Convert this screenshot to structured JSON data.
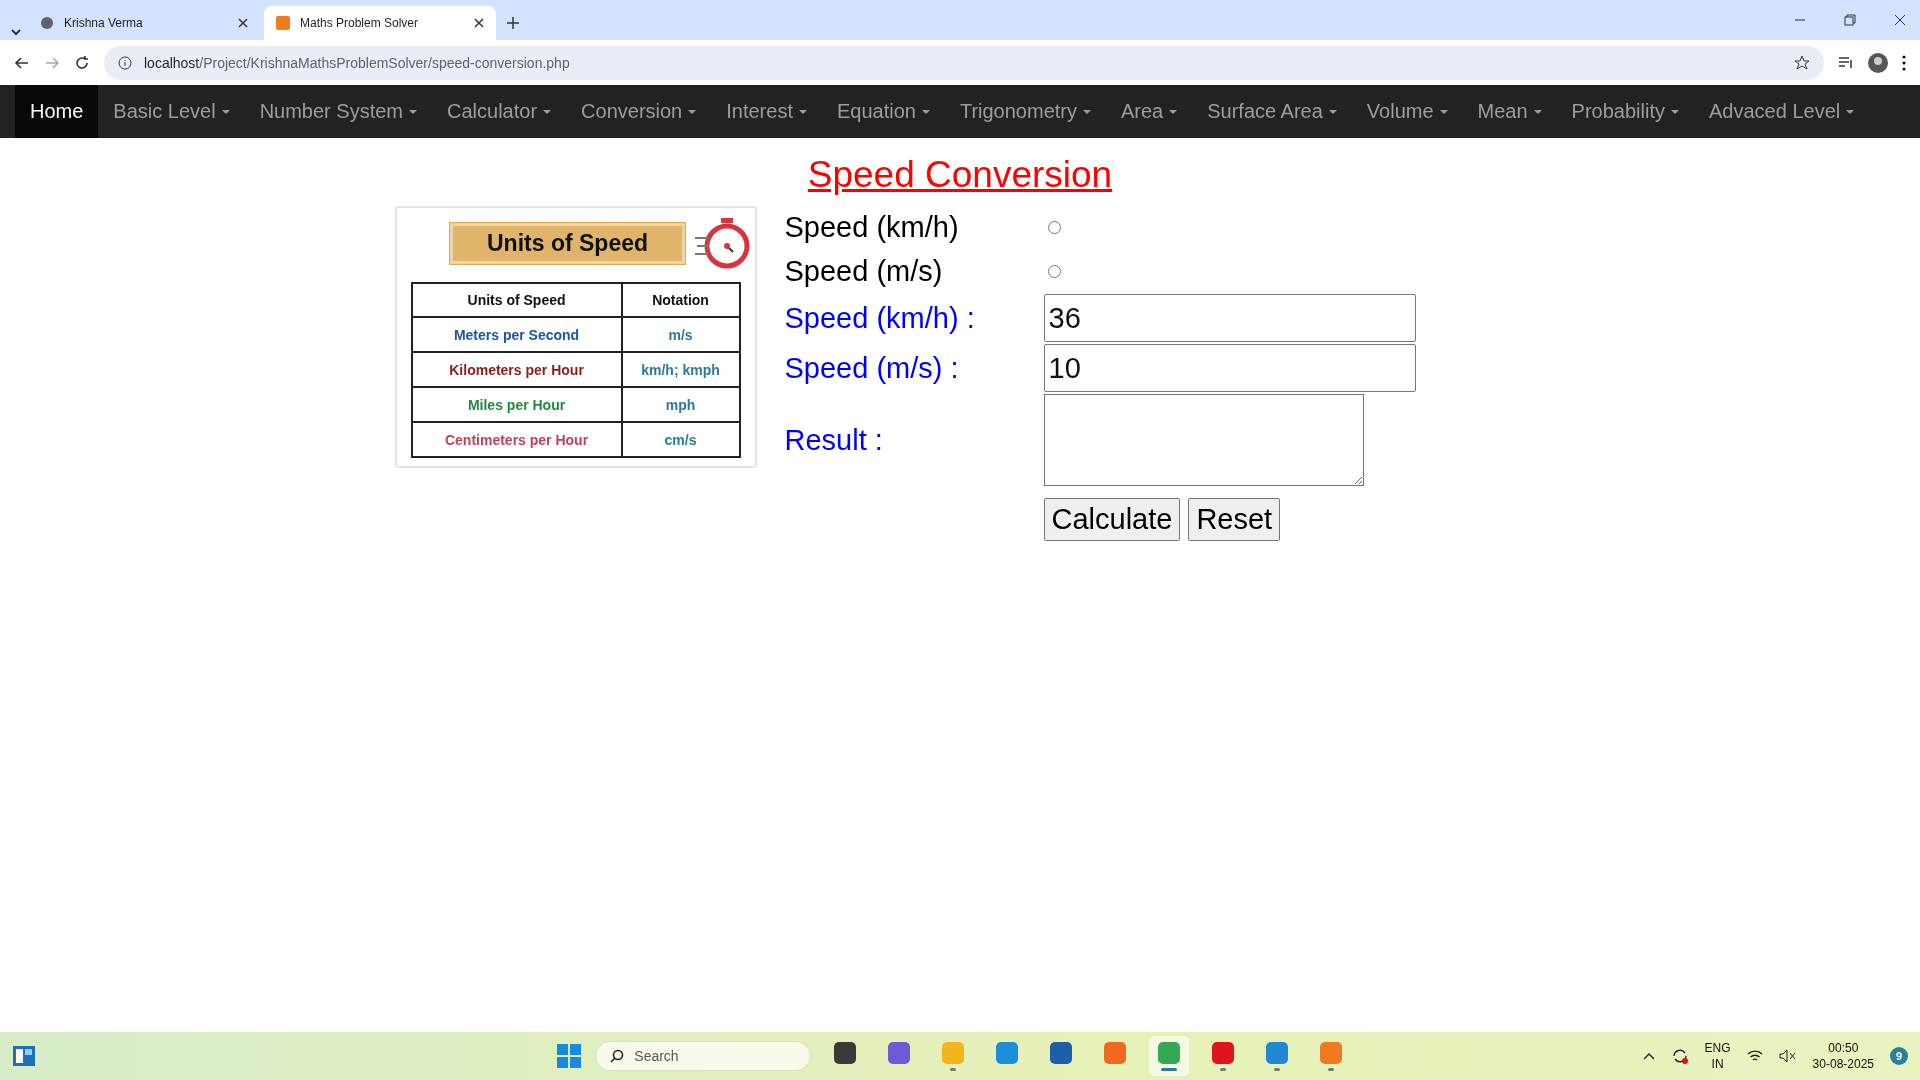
{
  "browser": {
    "tabs": [
      {
        "title": "Krishna Verma",
        "selected": false
      },
      {
        "title": "Maths Problem Solver",
        "selected": true
      }
    ],
    "url_host": "localhost",
    "url_path": "/Project/KrishnaMathsProblemSolver/speed-conversion.php"
  },
  "nav": [
    {
      "label": "Home",
      "selected": true,
      "dropdown": false
    },
    {
      "label": "Basic Level",
      "selected": false,
      "dropdown": true
    },
    {
      "label": "Number System",
      "selected": false,
      "dropdown": true
    },
    {
      "label": "Calculator",
      "selected": false,
      "dropdown": true
    },
    {
      "label": "Conversion",
      "selected": false,
      "dropdown": true
    },
    {
      "label": "Interest",
      "selected": false,
      "dropdown": true
    },
    {
      "label": "Equation",
      "selected": false,
      "dropdown": true
    },
    {
      "label": "Trigonometry",
      "selected": false,
      "dropdown": true
    },
    {
      "label": "Area",
      "selected": false,
      "dropdown": true
    },
    {
      "label": "Surface Area",
      "selected": false,
      "dropdown": true
    },
    {
      "label": "Volume",
      "selected": false,
      "dropdown": true
    },
    {
      "label": "Mean",
      "selected": false,
      "dropdown": true
    },
    {
      "label": "Probability",
      "selected": false,
      "dropdown": true
    },
    {
      "label": "Advaced Level",
      "selected": false,
      "dropdown": true
    }
  ],
  "page_title": "Speed Conversion",
  "info_card": {
    "heading": "Units of Speed",
    "columns": [
      "Units of Speed",
      "Notation"
    ],
    "rows": [
      {
        "unit": "Meters per Second",
        "notation": "m/s",
        "color": "#1a55a8"
      },
      {
        "unit": "Kilometers per Hour",
        "notation": "km/h; kmph",
        "color": "#8a1c1c"
      },
      {
        "unit": "Miles per Hour",
        "notation": "mph",
        "color": "#1e8a3e"
      },
      {
        "unit": "Centimeters per Hour",
        "notation": "cm/s",
        "color": "#c0405a"
      }
    ]
  },
  "form": {
    "options": [
      {
        "label": "Speed (km/h)",
        "selected": false
      },
      {
        "label": "Speed (m/s)",
        "selected": false
      }
    ],
    "fields": [
      {
        "label": "Speed (km/h) :",
        "value": "36"
      },
      {
        "label": "Speed (m/s) :",
        "value": "10"
      }
    ],
    "result_label": "Result :",
    "buttons": [
      "Calculate",
      "Reset"
    ]
  },
  "taskbar": {
    "search_placeholder": "Search",
    "apps": [
      {
        "running": false,
        "selected": false,
        "color": "#3a3a3a"
      },
      {
        "running": false,
        "selected": false,
        "color": "#6b5bd6"
      },
      {
        "running": true,
        "selected": false,
        "color": "#f2b51d"
      },
      {
        "running": false,
        "selected": false,
        "color": "#1c8fd8"
      },
      {
        "running": false,
        "selected": false,
        "color": "#1f5fa8"
      },
      {
        "running": false,
        "selected": false,
        "color": "#f06a1e"
      },
      {
        "running": true,
        "selected": true,
        "color": "#34a853"
      },
      {
        "running": true,
        "selected": false,
        "color": "#e0141e"
      },
      {
        "running": true,
        "selected": false,
        "color": "#1f8ad2"
      },
      {
        "running": true,
        "selected": false,
        "color": "#f07b1e"
      }
    ],
    "lang": "ENG",
    "region": "IN",
    "time": "00:50",
    "date": "30-08-2025",
    "badge": "9"
  }
}
